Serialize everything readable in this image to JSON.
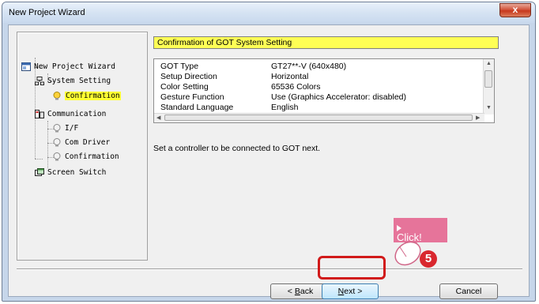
{
  "window": {
    "title": "New Project Wizard",
    "close_label": "x"
  },
  "tree": {
    "items": [
      {
        "label": "New Project Wizard",
        "icon": "wizard-icon"
      },
      {
        "label": "System Setting",
        "icon": "system-setting-icon"
      },
      {
        "label": "Confirmation",
        "icon": "bulb-icon",
        "selected": true
      },
      {
        "label": "Communication",
        "icon": "communication-icon"
      },
      {
        "label": "I/F",
        "icon": "bulb-icon"
      },
      {
        "label": "Com Driver",
        "icon": "bulb-icon"
      },
      {
        "label": "Confirmation",
        "icon": "bulb-icon"
      },
      {
        "label": "Screen Switch",
        "icon": "screen-switch-icon"
      }
    ]
  },
  "panel": {
    "header": "Confirmation of GOT System Setting",
    "rows": [
      {
        "key": "GOT Type",
        "value": "GT27**-V (640x480)"
      },
      {
        "key": "Setup Direction",
        "value": "Horizontal"
      },
      {
        "key": "Color Setting",
        "value": "65536 Colors"
      },
      {
        "key": "Gesture Function",
        "value": "Use (Graphics Accelerator: disabled)"
      },
      {
        "key": "Standard Language",
        "value": "English"
      }
    ],
    "note": "Set a controller to be connected to GOT next."
  },
  "buttons": {
    "back": "< Back",
    "next": "Next >",
    "cancel": "Cancel"
  },
  "annotation": {
    "callout": "Click!",
    "step": "5"
  },
  "colors": {
    "header_highlight": "#ffff55",
    "selected_item": "#ffff33",
    "annotation_red": "#d11a1a",
    "callout_pink": "#e6749a"
  }
}
